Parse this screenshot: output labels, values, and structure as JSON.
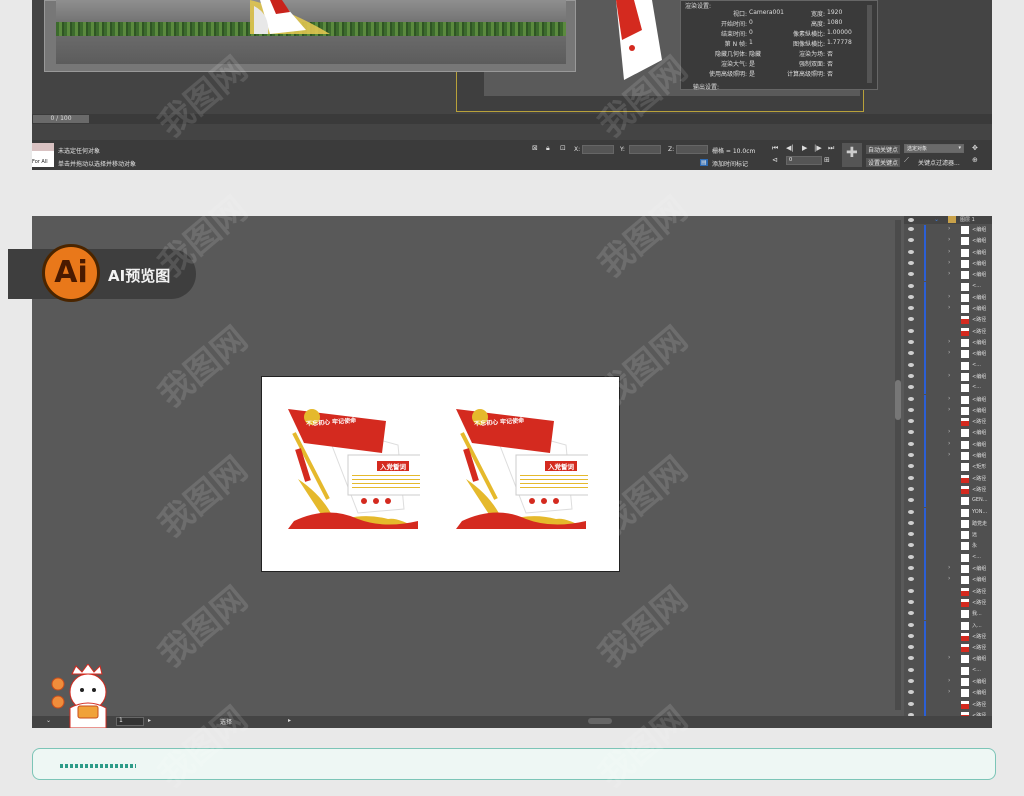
{
  "max": {
    "time_slider": "0 / 100",
    "status_line1": "未选定任何对象",
    "status_line2": "单击并拖动以选择并移动对象",
    "left_box": "For All",
    "coord_x": "X:",
    "coord_y": "Y:",
    "coord_z": "Z:",
    "grid": "栅格 = 10.0cm",
    "add_time_tag": "添加时间标记",
    "auto_key": "自动关键点",
    "set_key": "设置关键点",
    "selection_dropdown": "选定对象",
    "key_filters": "关键点过滤器...",
    "frame_value": "0",
    "dialog": {
      "section": "渲染设置:",
      "rows": [
        {
          "label": "视口:",
          "value": "Camera001",
          "label2": "宽度:",
          "value2": "1920"
        },
        {
          "label": "开始时间:",
          "value": "0",
          "label2": "高度:",
          "value2": "1080"
        },
        {
          "label": "结束时间:",
          "value": "0",
          "label2": "像素纵横比:",
          "value2": "1.00000"
        },
        {
          "label": "第 N 帧:",
          "value": "1",
          "label2": "图像纵横比:",
          "value2": "1.77778"
        },
        {
          "label": "隐藏几何体:",
          "value": "隐藏",
          "label2": "渲染为场:",
          "value2": "否"
        },
        {
          "label": "渲染大气:",
          "value": "是",
          "label2": "强制双面:",
          "value2": "否"
        },
        {
          "label": "使用高级照明:",
          "value": "是",
          "label2": "计算高级照明:",
          "value2": "否"
        }
      ],
      "footer": "输出设置:"
    }
  },
  "ai": {
    "badge_logo": "Ai",
    "badge_label": "AI预览图",
    "bottom_zoom": "1",
    "bottom_tool": "选择",
    "layer_header": "图层 1",
    "layers": [
      "<编组",
      "<编组",
      "<编组",
      "<编组",
      "<编组",
      "<...",
      "<编组",
      "<编组",
      "<路径",
      "<路径",
      "<编组",
      "<编组",
      "<...",
      "<编组",
      "<...",
      "<编组",
      "<编组",
      "<路径",
      "<编组",
      "<编组",
      "<编组",
      "<矩形",
      "<路径",
      "<路径",
      "GEN...",
      "YON...",
      "踏党走",
      "远",
      "永",
      "<...",
      "<编组",
      "<编组",
      "<路径",
      "<路径",
      "我...",
      "入...",
      "<路径",
      "<路径",
      "<编组",
      "<...",
      "<编组",
      "<编组",
      "<路径",
      "<路径"
    ]
  },
  "artboard": {
    "signs": [
      {
        "banner_text": "不忘初心 牢记使命",
        "title": "入党誓词"
      },
      {
        "banner_text": "不忘初心 牢记使命",
        "title": "入党誓词"
      }
    ]
  },
  "watermark": "我图网",
  "colors": {
    "accent_red": "#d42a1f",
    "gold": "#e5b92c",
    "badge_orange": "#e9781a"
  }
}
